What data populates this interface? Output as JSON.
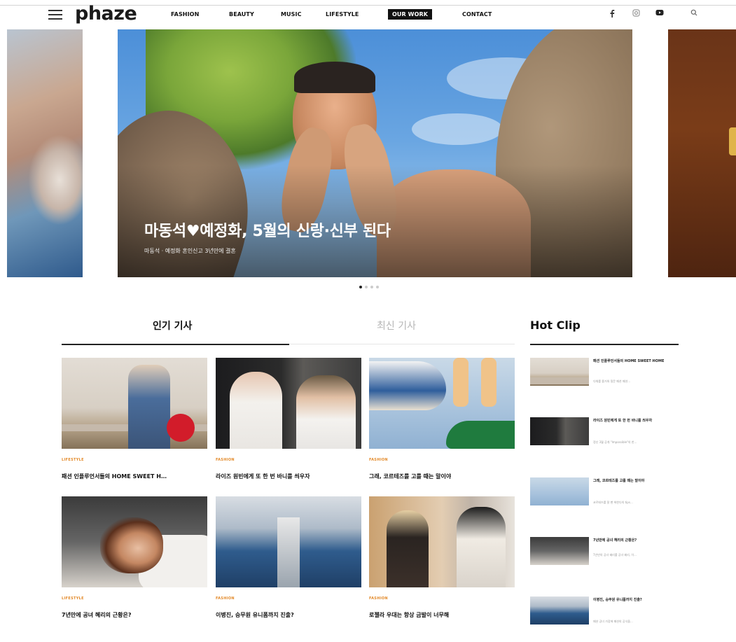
{
  "header": {
    "logo": "phaze",
    "nav": [
      {
        "label": "FASHION",
        "active": false
      },
      {
        "label": "BEAUTY",
        "active": false
      },
      {
        "label": "MUSIC",
        "active": false
      },
      {
        "label": "LIFESTYLE",
        "active": false
      },
      {
        "label": "OUR WORK",
        "active": true
      },
      {
        "label": "CONTACT",
        "active": false
      }
    ],
    "social_icons": [
      "facebook-icon",
      "instagram-icon",
      "youtube-icon",
      "search-icon"
    ]
  },
  "hero": {
    "title": "마동석♥예정화, 5월의 신랑·신부 된다",
    "subtitle": "마동석 · 예정화 혼인신고 3년만에 결혼",
    "dots": [
      true,
      false,
      false,
      false
    ]
  },
  "tabs": [
    {
      "label": "인기 기사",
      "active": true
    },
    {
      "label": "최신 기사",
      "active": false
    }
  ],
  "hot_clip": {
    "title": "Hot Clip"
  },
  "articles": [
    {
      "category": "LIFESTYLE",
      "title": "패션 인플루언서들의 HOME SWEET H…"
    },
    {
      "category": "FASHION",
      "title": "라이즈 원빈에게 또 한 번 바니를 씌우자"
    },
    {
      "category": "FASHION",
      "title": "그래, 코르테즈를 고를 때는 말이야"
    },
    {
      "category": "LIFESTYLE",
      "title": "7년만에 공녀 혜리의 근황은?"
    },
    {
      "category": "FASHION",
      "title": "이병진, 승무원 유니폼까지 진출?"
    },
    {
      "category": "FASHION",
      "title": "로젤라 우대는 항상 금발이 너무해"
    }
  ],
  "clips": [
    {
      "title": "패션 인플루언서들의 HOME SWEET HOME",
      "desc": "다채를 즐거워 질문 패션 패션…"
    },
    {
      "title": "라이즈 원빈에게 또 한 번 바니를 씌우자",
      "desc": "정신 3월 공개 \"Impossible\"의 한…"
    },
    {
      "title": "그래, 코르테즈를 고를 때는 말이야",
      "desc": "코르테즈를 잘 팬 위한다의 tips…"
    },
    {
      "title": "7년만에 공녀 혜리의 근황은?",
      "desc": "7년만의 공녀 혜리를 공녀 혜리, 이…"
    },
    {
      "title": "이병진, 승무원 유니폼까지 진출?",
      "desc": "패션 공녀 가장에 패션의 공식을…"
    }
  ]
}
